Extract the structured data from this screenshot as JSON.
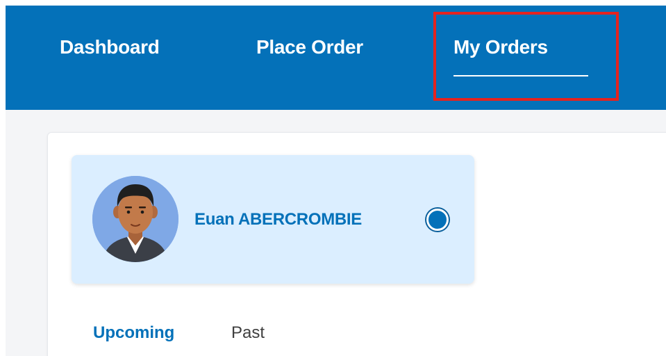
{
  "nav": {
    "items": [
      {
        "label": "Dashboard"
      },
      {
        "label": "Place Order"
      },
      {
        "label": "My Orders",
        "active": true
      }
    ]
  },
  "customer": {
    "name": "Euan ABERCROMBIE",
    "selected": true
  },
  "tabs": [
    {
      "label": "Upcoming",
      "active": true
    },
    {
      "label": "Past"
    }
  ],
  "colors": {
    "brand": "#0471b9",
    "highlight": "#e5231f",
    "customer_card": "#dbeeff",
    "page_bg": "#f4f5f7"
  }
}
